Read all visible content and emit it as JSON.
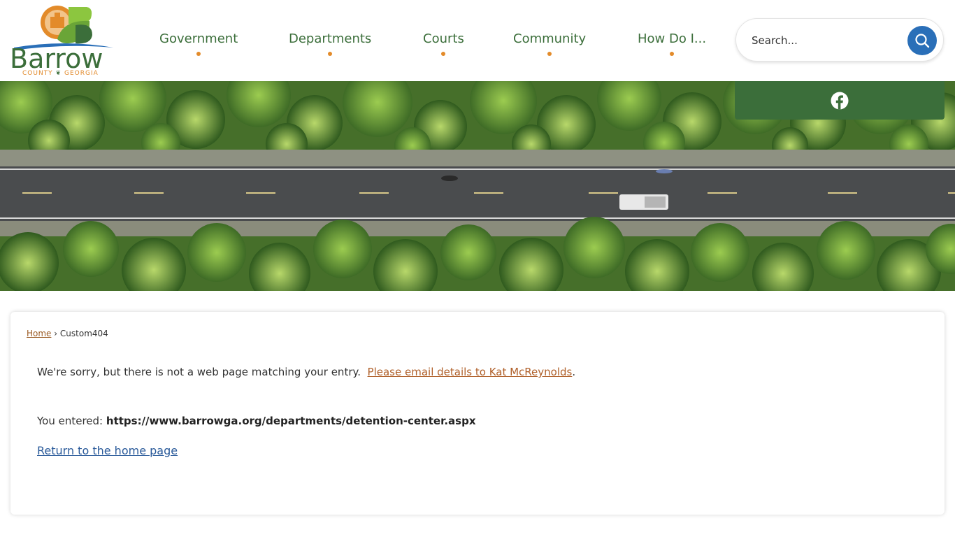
{
  "logo": {
    "word": "Barrow",
    "county": "COUNTY",
    "state": "GEORGIA"
  },
  "nav": {
    "items": [
      {
        "label": "Government"
      },
      {
        "label": "Departments"
      },
      {
        "label": "Courts"
      },
      {
        "label": "Community"
      },
      {
        "label": "How Do I..."
      }
    ]
  },
  "search": {
    "placeholder": "Search..."
  },
  "social": {
    "facebook_icon": "facebook-icon"
  },
  "colors": {
    "brand_green": "#3b6e3a",
    "accent_orange": "#e38b2a",
    "search_blue": "#2a6fb8",
    "link_brown": "#b0602a",
    "link_blue": "#2a5a9a"
  },
  "breadcrumb": {
    "home": "Home",
    "separator": "›",
    "current": "Custom404"
  },
  "content": {
    "sorry_text": "We're sorry, but there is not a web page matching your entry.",
    "email_link": "Please email details to Kat McReynolds",
    "period": ".",
    "entered_label": "You entered:",
    "entered_url": "https://www.barrowga.org/departments/detention-center.aspx",
    "return_link": "Return to the home page"
  }
}
